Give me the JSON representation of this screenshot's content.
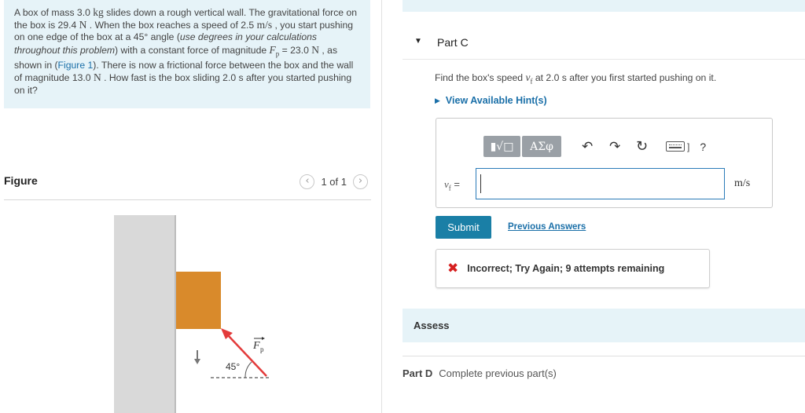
{
  "problem": {
    "s1": "A box of mass 3.0 ",
    "u_kg": "kg",
    "s2": " slides down a rough vertical wall. The gravitational force on the box is 29.4 ",
    "u_N1": "N",
    "s3": " . When the box reaches a speed of 2.5 ",
    "u_ms": "m/s",
    "s4": " , you start pushing on one edge of the box at a 45° angle (",
    "em": "use degrees in your calculations throughout this problem",
    "s5": ") with a constant force of magnitude ",
    "fp": "F",
    "fp_sub": "p",
    "s6": " = 23.0 ",
    "u_N2": "N",
    "s7": " , as shown in (",
    "fig_link": "Figure 1",
    "s8": "). There is now a frictional force between the box and the wall of magnitude 13.0 ",
    "u_N3": "N",
    "s9": " . How fast is the box sliding 2.0 s after you started pushing on it?"
  },
  "figure": {
    "title": "Figure",
    "counter": "1 of 1",
    "prev_icon": "chevron-left-icon",
    "next_icon": "chevron-right-icon",
    "angle_label": "45°",
    "force_label": "F",
    "force_sub": "p",
    "colors": {
      "wall": "#d9d9d9",
      "box": "#d98a2b",
      "arrow": "#e33b3b"
    }
  },
  "part_c": {
    "title": "Part C",
    "question_pre": "Find the box's speed ",
    "var": "v",
    "var_sub": "f",
    "question_post": " at 2.0 s after you first started pushing on it.",
    "hint": "View Available Hint(s)",
    "templates_btn": "▮√□",
    "greek_btn": "ΑΣφ",
    "help": "?",
    "input_label_eq": " =",
    "input_value": "",
    "unit": "m/s",
    "submit": "Submit",
    "previous_answers": "Previous Answers",
    "feedback": "Incorrect; Try Again; 9 attempts remaining",
    "colors": {
      "submit": "#1a7fa6",
      "link": "#1a6fa8",
      "error": "#d61f1f",
      "band": "#e6f3f8"
    }
  },
  "assess": {
    "label": "Assess"
  },
  "part_d": {
    "label": "Part D",
    "status": "Complete previous part(s)"
  }
}
